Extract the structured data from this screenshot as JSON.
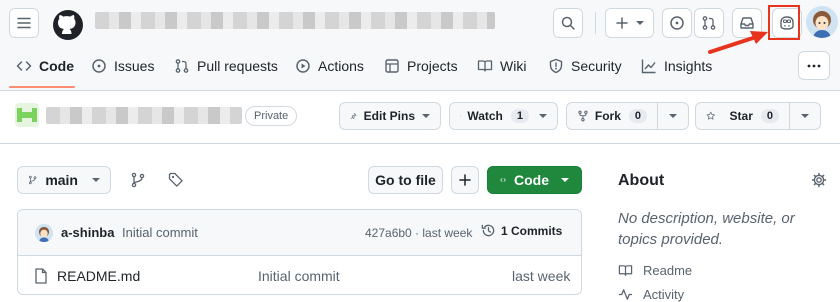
{
  "header": {
    "menu_icon": "hamburger-icon",
    "logo_icon": "github-logo-icon",
    "repo_path_redacted": true
  },
  "nav": {
    "tabs": [
      {
        "label": "Code",
        "icon": "code-icon",
        "active": true
      },
      {
        "label": "Issues",
        "icon": "issue-icon"
      },
      {
        "label": "Pull requests",
        "icon": "pull-request-icon"
      },
      {
        "label": "Actions",
        "icon": "play-icon"
      },
      {
        "label": "Projects",
        "icon": "table-icon"
      },
      {
        "label": "Wiki",
        "icon": "book-icon"
      },
      {
        "label": "Security",
        "icon": "shield-icon"
      },
      {
        "label": "Insights",
        "icon": "graph-icon"
      }
    ]
  },
  "repo": {
    "visibility": "Private",
    "edit_pins": "Edit Pins",
    "watch": {
      "label": "Watch",
      "count": "1"
    },
    "fork": {
      "label": "Fork",
      "count": "0"
    },
    "star": {
      "label": "Star",
      "count": "0"
    }
  },
  "toolbar": {
    "branch": "main",
    "go_to_file": "Go to file",
    "code_button": "Code"
  },
  "commit": {
    "author": "a-shinba",
    "message": "Initial commit",
    "hash_time": "427a6b0 · last week",
    "commits_count": "1 Commits"
  },
  "files": [
    {
      "name": "README.md",
      "message": "Initial commit",
      "time": "last week"
    }
  ],
  "about": {
    "title": "About",
    "description": "No description, website, or topics provided.",
    "readme": "Readme",
    "activity": "Activity"
  },
  "colors": {
    "green": "#1f883d",
    "annotation_red": "#e8341c",
    "tab_underline": "#fd8c73"
  }
}
